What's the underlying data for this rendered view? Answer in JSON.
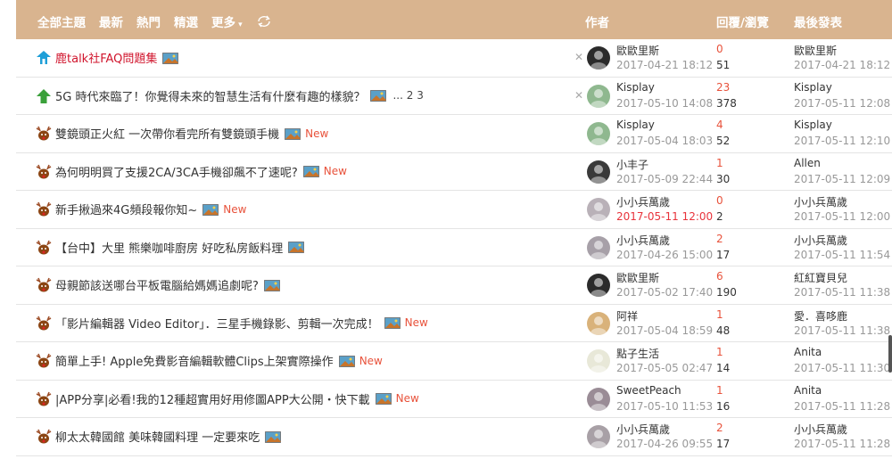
{
  "header": {
    "tabs": [
      "全部主題",
      "最新",
      "熱門",
      "精選",
      "更多"
    ],
    "col_author": "作者",
    "col_stats": "回覆/瀏覽",
    "col_last": "最後發表"
  },
  "colors": {
    "header_bg": "#d9b48f",
    "highlight": "#d0142c",
    "new": "#e8523b"
  },
  "rows": [
    {
      "icon": "pin-house-icon",
      "title": "鹿talk社FAQ問題集",
      "new": "",
      "pages": "",
      "author": "歐歐里斯",
      "adate": "2017-04-21 18:12",
      "replies": "0",
      "views": "51",
      "luser": "歐歐里斯",
      "ldate": "2017-04-21 18:12"
    },
    {
      "icon": "pin-up-icon",
      "title": "5G 時代來臨了！你覺得未來的智慧生活有什麼有趣的樣貌？",
      "new": "",
      "pages": "... 2 3",
      "author": "Kisplay",
      "adate": "2017-05-10 14:08",
      "replies": "23",
      "views": "378",
      "luser": "Kisplay",
      "ldate": "2017-05-11 12:08"
    },
    {
      "icon": "reindeer-icon",
      "title": "雙鏡頭正火紅 一次帶你看完所有雙鏡頭手機",
      "new": "New",
      "pages": "",
      "author": "Kisplay",
      "adate": "2017-05-04 18:03",
      "replies": "4",
      "views": "52",
      "luser": "Kisplay",
      "ldate": "2017-05-11 12:10"
    },
    {
      "icon": "reindeer-icon",
      "title": "為何明明買了支援2CA/3CA手機卻飆不了速呢?",
      "new": "New",
      "pages": "",
      "author": "小丰子",
      "adate": "2017-05-09 22:44",
      "replies": "1",
      "views": "30",
      "luser": "Allen",
      "ldate": "2017-05-11 12:09"
    },
    {
      "icon": "reindeer-icon",
      "title": "新手揪過來4G頻段報你知~",
      "new": "New",
      "pages": "",
      "author": "小小兵萬歲",
      "adate": "2017-05-11 12:00",
      "replies": "0",
      "views": "2",
      "luser": "小小兵萬歲",
      "ldate": "2017-05-11 12:00"
    },
    {
      "icon": "reindeer-icon",
      "title": "【台中】大里 熊樂咖啡廚房 好吃私房飯料理",
      "new": "",
      "pages": "",
      "author": "小小兵萬歲",
      "adate": "2017-04-26 15:00",
      "replies": "2",
      "views": "17",
      "luser": "小小兵萬歲",
      "ldate": "2017-05-11 11:54"
    },
    {
      "icon": "reindeer-icon",
      "title": "母親節該送哪台平板電腦給媽媽追劇呢?",
      "new": "",
      "pages": "",
      "author": "歐歐里斯",
      "adate": "2017-05-02 17:40",
      "replies": "6",
      "views": "190",
      "luser": "紅紅寶貝兒",
      "ldate": "2017-05-11 11:38"
    },
    {
      "icon": "reindeer-icon",
      "title": "「影片編輯器 Video Editor」．三星手機錄影、剪輯一次完成！",
      "new": "New",
      "pages": "",
      "author": "阿祥",
      "adate": "2017-05-04 18:59",
      "replies": "1",
      "views": "48",
      "luser": "愛．喜哆鹿",
      "ldate": "2017-05-11 11:38"
    },
    {
      "icon": "reindeer-icon",
      "title": "簡單上手! Apple免費影音編輯軟體Clips上架實際操作",
      "new": "New",
      "pages": "",
      "author": "點子生活",
      "adate": "2017-05-05 02:47",
      "replies": "1",
      "views": "14",
      "luser": "Anita",
      "ldate": "2017-05-11 11:30"
    },
    {
      "icon": "reindeer-icon",
      "title": "|APP分享|必看!我的12種超實用好用修圖APP大公開・快下載",
      "new": "New",
      "pages": "",
      "author": "SweetPeach",
      "adate": "2017-05-10 11:53",
      "replies": "1",
      "views": "16",
      "luser": "Anita",
      "ldate": "2017-05-11 11:28"
    },
    {
      "icon": "reindeer-icon",
      "title": "柳太太韓國館 美味韓國料理 一定要來吃",
      "new": "",
      "pages": "",
      "author": "小小兵萬歲",
      "adate": "2017-04-26 09:55",
      "replies": "2",
      "views": "17",
      "luser": "小小兵萬歲",
      "ldate": "2017-05-11 11:28"
    }
  ]
}
